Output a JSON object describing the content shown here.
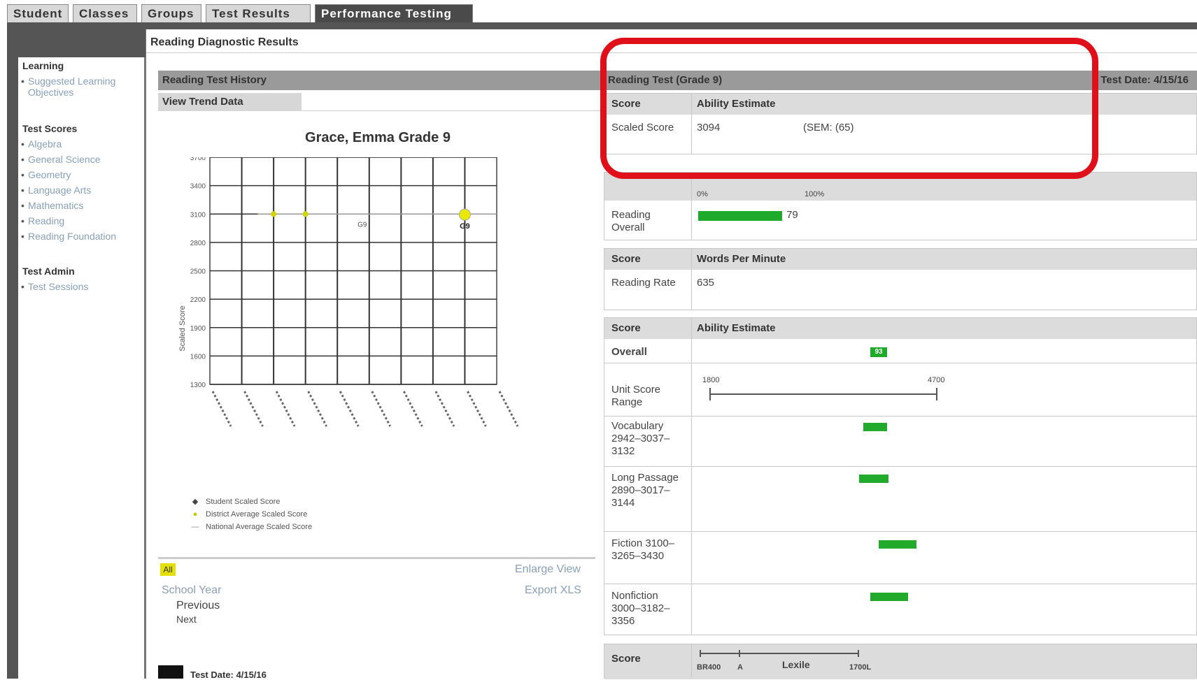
{
  "tabs": [
    "Student",
    "Classes",
    "Groups",
    "Test Results",
    "Performance Testing"
  ],
  "header": {
    "title": "Reading Diagnostic Results"
  },
  "sidebar": {
    "learning": {
      "heading": "Learning",
      "items": [
        "Suggested Learning Objectives"
      ]
    },
    "test_scores": {
      "heading": "Test Scores",
      "items": [
        "Algebra",
        "General Science",
        "Geometry",
        "Language Arts",
        "Mathematics",
        "Reading",
        "Reading Foundation"
      ]
    },
    "test_admin": {
      "heading": "Test Admin",
      "items": [
        "Test Sessions"
      ]
    }
  },
  "history": {
    "title": "Reading Test History",
    "tab": "View Trend Data",
    "chart_title": "Grace, Emma Grade 9",
    "ylabel": "Scaled Score",
    "marker_label": "G9",
    "point_label": "G9",
    "legend": [
      "Student Scaled Score",
      "District Average Scaled Score",
      "National Average Scaled Score"
    ],
    "all_label": "All",
    "enlarge": "Enlarge View",
    "export": "Export XLS",
    "school_year": "School Year",
    "previous": "Previous",
    "next": "Next",
    "test_date_footer": "Test Date: 4/15/16"
  },
  "chart_data": {
    "type": "line",
    "title": "Grace, Emma Grade 9",
    "ylabel": "Scaled Score",
    "xlabel": "",
    "ylim": [
      1300,
      3700
    ],
    "yticks": [
      1300,
      1600,
      1900,
      2200,
      2500,
      2800,
      3100,
      3400,
      3700
    ],
    "series": [
      {
        "name": "Student Scaled Score",
        "points": [
          [
            8,
            3094
          ]
        ],
        "label": "G9"
      },
      {
        "name": "District Average Scaled Score",
        "points": [
          [
            2,
            3100
          ],
          [
            3,
            3100
          ],
          [
            8,
            3100
          ]
        ]
      },
      {
        "name": "National Average Scaled Score",
        "points": [
          [
            1.5,
            3100
          ],
          [
            9,
            3100
          ]
        ]
      }
    ],
    "grid": true
  },
  "test": {
    "title": "Reading Test (Grade 9)",
    "date_label": "Test Date: 4/15/16",
    "score_header": "Score",
    "ability_header": "Ability Estimate",
    "scaled_score_label": "Scaled Score",
    "scaled_score": "3094",
    "sem": "(SEM: (65)",
    "pct_min": "0%",
    "pct_max": "100%",
    "reading_overall_label": "Reading Overall",
    "reading_overall_value": "79",
    "reading_overall_fraction": 0.79,
    "wpm_header": "Words Per Minute",
    "reading_rate_label": "Reading Rate",
    "reading_rate_value": "635",
    "overall_label": "Overall",
    "overall_badge": "93",
    "unit_range_label": "Unit Score Range",
    "unit_min": "1800",
    "unit_max": "4700",
    "vocabulary_label": "Vocabulary 2942–3037–3132",
    "long_passage_label": "Long Passage 2890–3017–3144",
    "fiction_label": "Fiction 3100–3265–3430",
    "nonfiction_label": "Nonfiction 3000–3182–3356",
    "lexile_label": "Lexile",
    "lexile_min": "BR400",
    "lexile_a": "A",
    "lexile_max": "1700L"
  }
}
